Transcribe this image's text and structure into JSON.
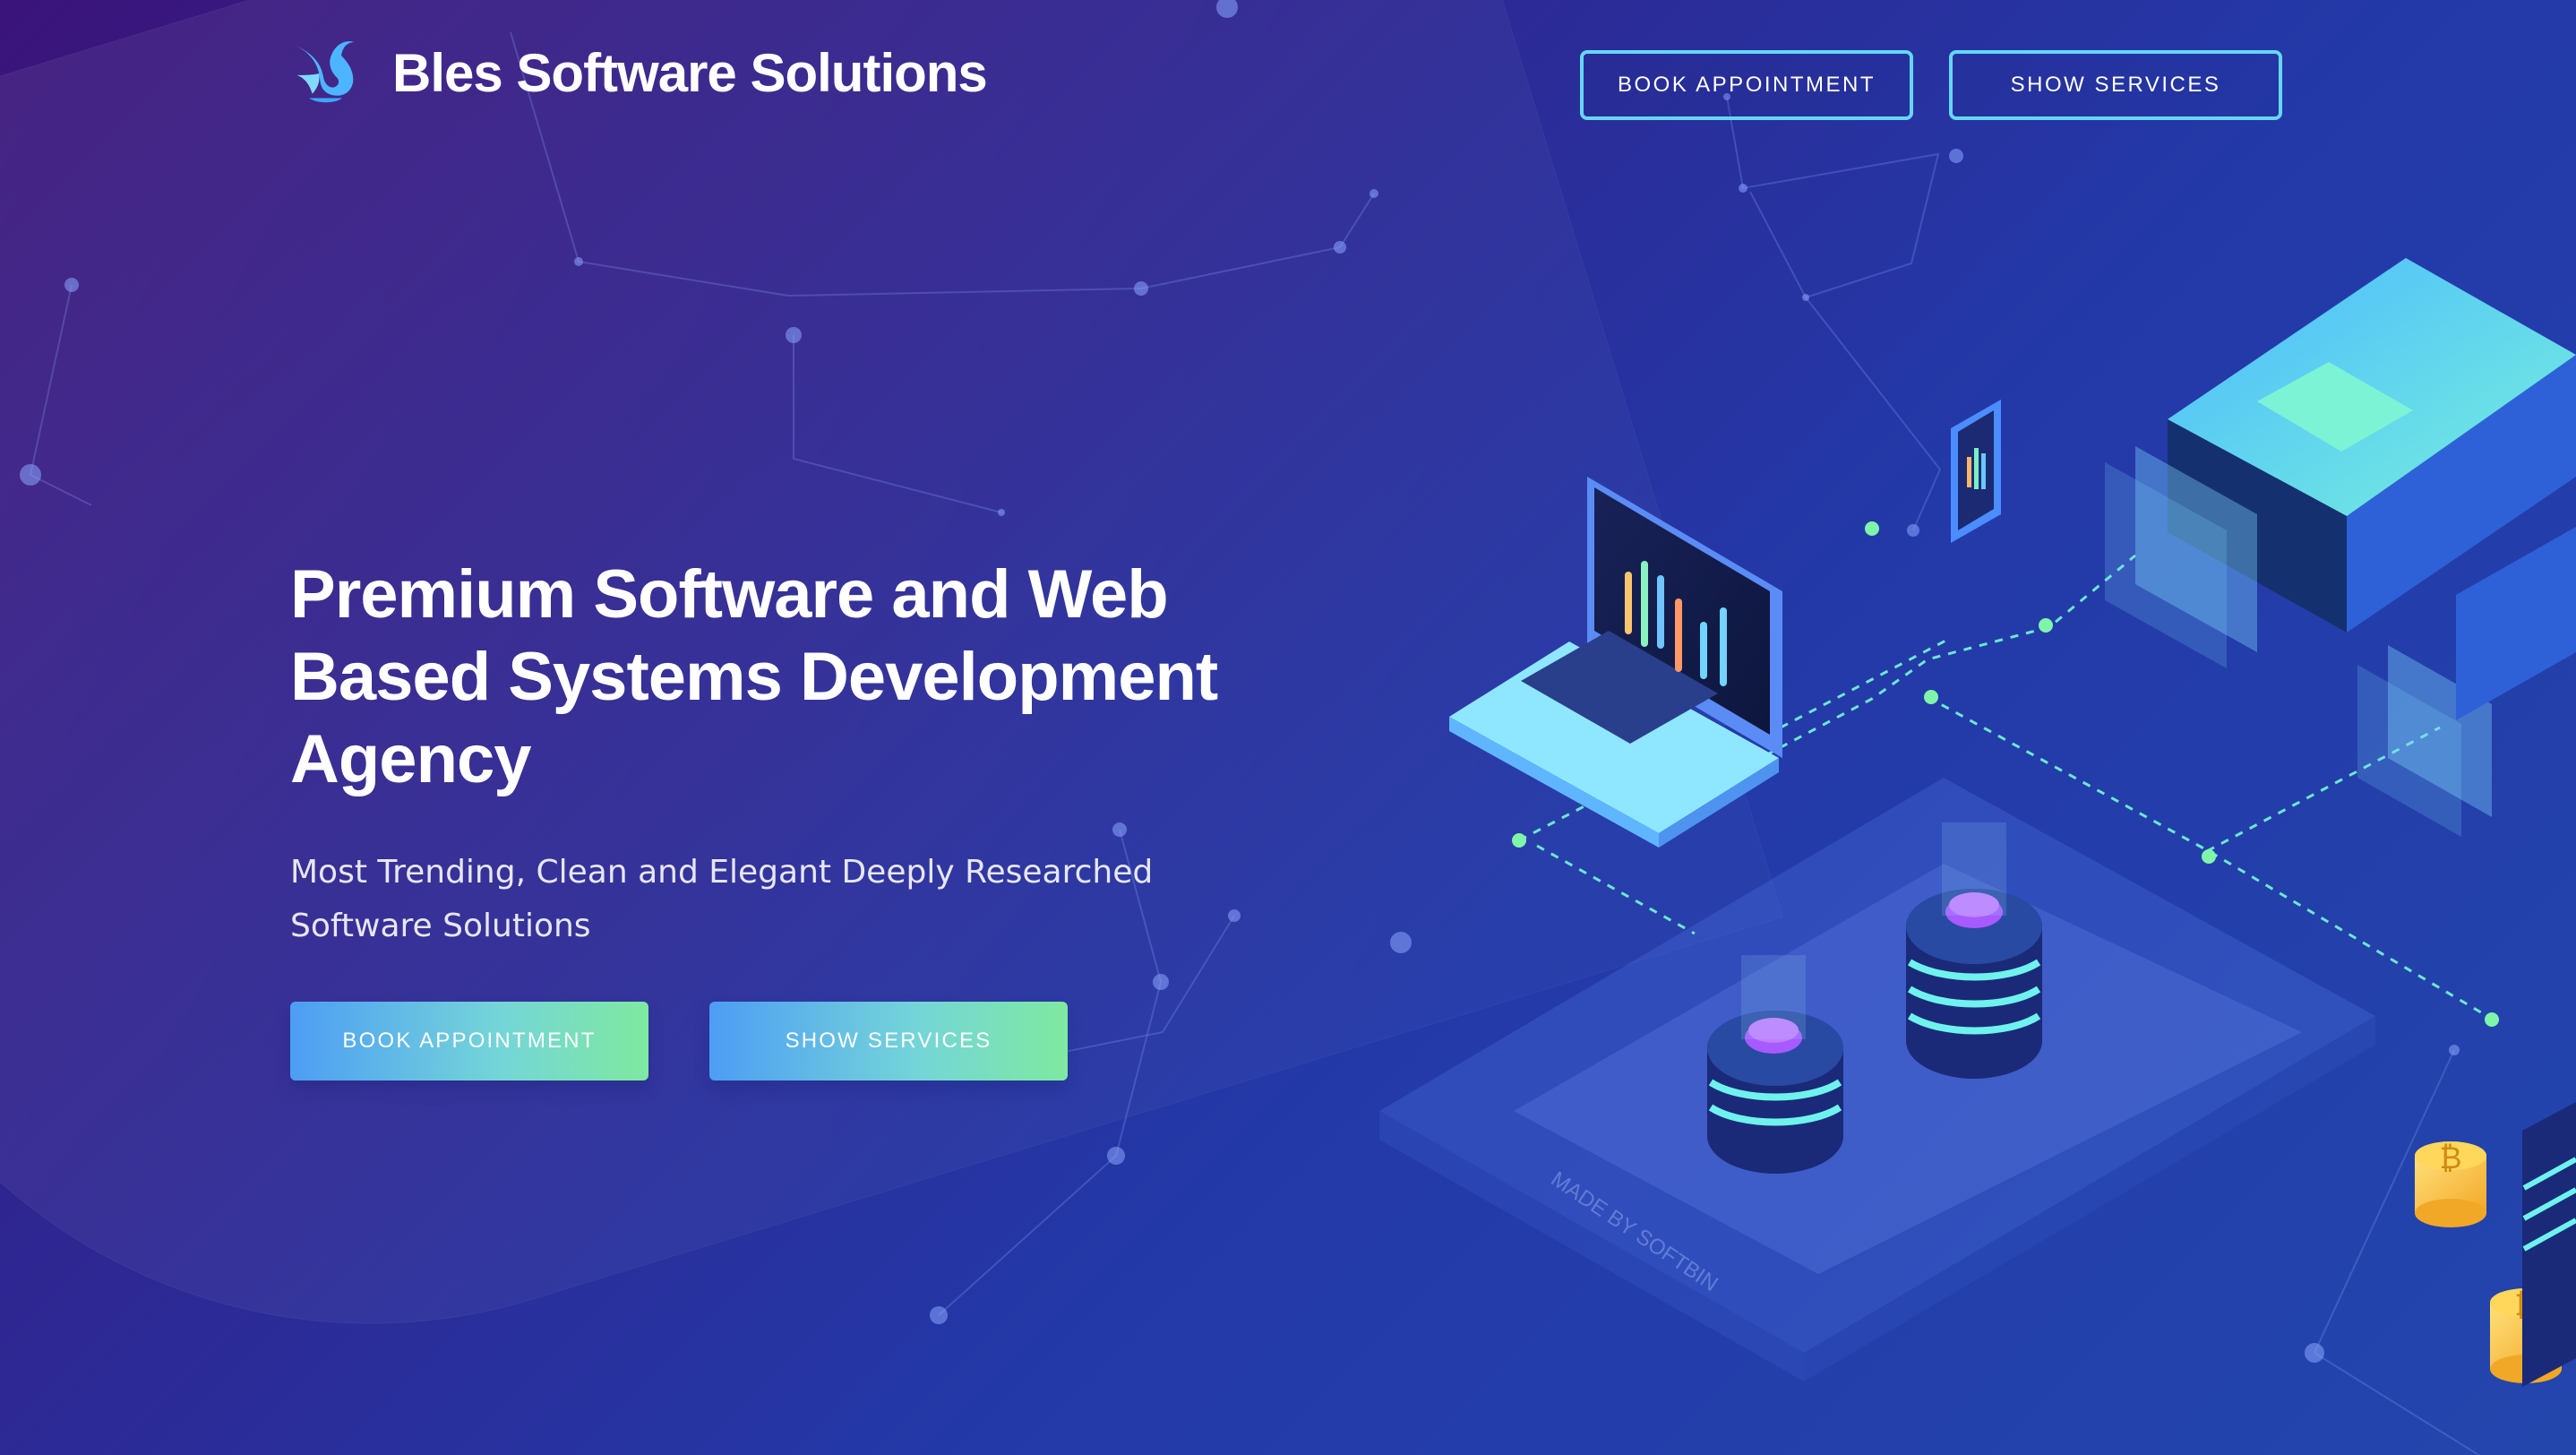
{
  "brand": {
    "name": "Bles Software Solutions",
    "icon": "swan-icon"
  },
  "header": {
    "book_label": "BOOK APPOINTMENT",
    "services_label": "SHOW SERVICES"
  },
  "hero": {
    "title": "Premium Software and Web Based Systems Development Agency",
    "subtitle": "Most Trending, Clean and Elegant Deeply Researched Software Solutions",
    "book_label": "BOOK APPOINTMENT",
    "services_label": "SHOW SERVICES"
  },
  "theme": {
    "primary_bg": "#3a147a",
    "secondary_bg": "#2346ad",
    "accent_cyan": "#66d6f8",
    "accent_green": "#7ee9a0",
    "illustration_dark": "#1a2a78"
  },
  "illustration": {
    "network_label": "network-lines",
    "server_icon": "server-icon",
    "phone_icon": "phone-icon",
    "laptop_icon": "laptop-icon",
    "coin_icon": "coin-icon"
  }
}
